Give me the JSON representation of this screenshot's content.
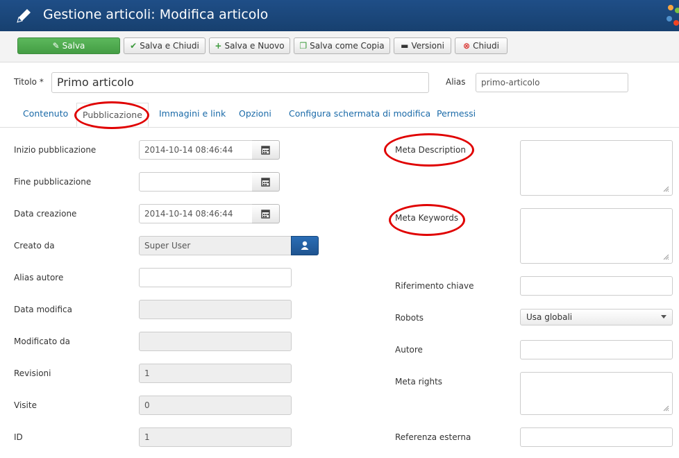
{
  "header": {
    "title": "Gestione articoli: Modifica articolo"
  },
  "toolbar": {
    "save": "Salva",
    "save_close": "Salva e Chiudi",
    "save_new": "Salva e Nuovo",
    "save_copy": "Salva come Copia",
    "versions": "Versioni",
    "close": "Chiudi"
  },
  "title_row": {
    "title_label": "Titolo *",
    "title_value": "Primo articolo",
    "alias_label": "Alias",
    "alias_value": "primo-articolo"
  },
  "tabs": [
    "Contenuto",
    "Pubblicazione",
    "Immagini e link",
    "Opzioni",
    "Configura schermata di modifica",
    "Permessi"
  ],
  "left": {
    "publish_up_label": "Inizio pubblicazione",
    "publish_up_value": "2014-10-14 08:46:44",
    "publish_down_label": "Fine pubblicazione",
    "publish_down_value": "",
    "created_label": "Data creazione",
    "created_value": "2014-10-14 08:46:44",
    "created_by_label": "Creato da",
    "created_by_value": "Super User",
    "author_alias_label": "Alias autore",
    "modified_label": "Data modifica",
    "modified_by_label": "Modificato da",
    "revisions_label": "Revisioni",
    "revisions_value": "1",
    "hits_label": "Visite",
    "hits_value": "0",
    "id_label": "ID",
    "id_value": "1"
  },
  "right": {
    "meta_desc_label": "Meta Description",
    "meta_keywords_label": "Meta Keywords",
    "key_ref_label": "Riferimento chiave",
    "robots_label": "Robots",
    "robots_value": "Usa globali",
    "author_label": "Autore",
    "rights_label": "Meta rights",
    "xref_label": "Referenza esterna"
  },
  "colors": {
    "header_bg": "#1f4e87",
    "save_green": "#5cb85c",
    "link_blue": "#1a6aa8",
    "highlight_red": "#e00000"
  }
}
